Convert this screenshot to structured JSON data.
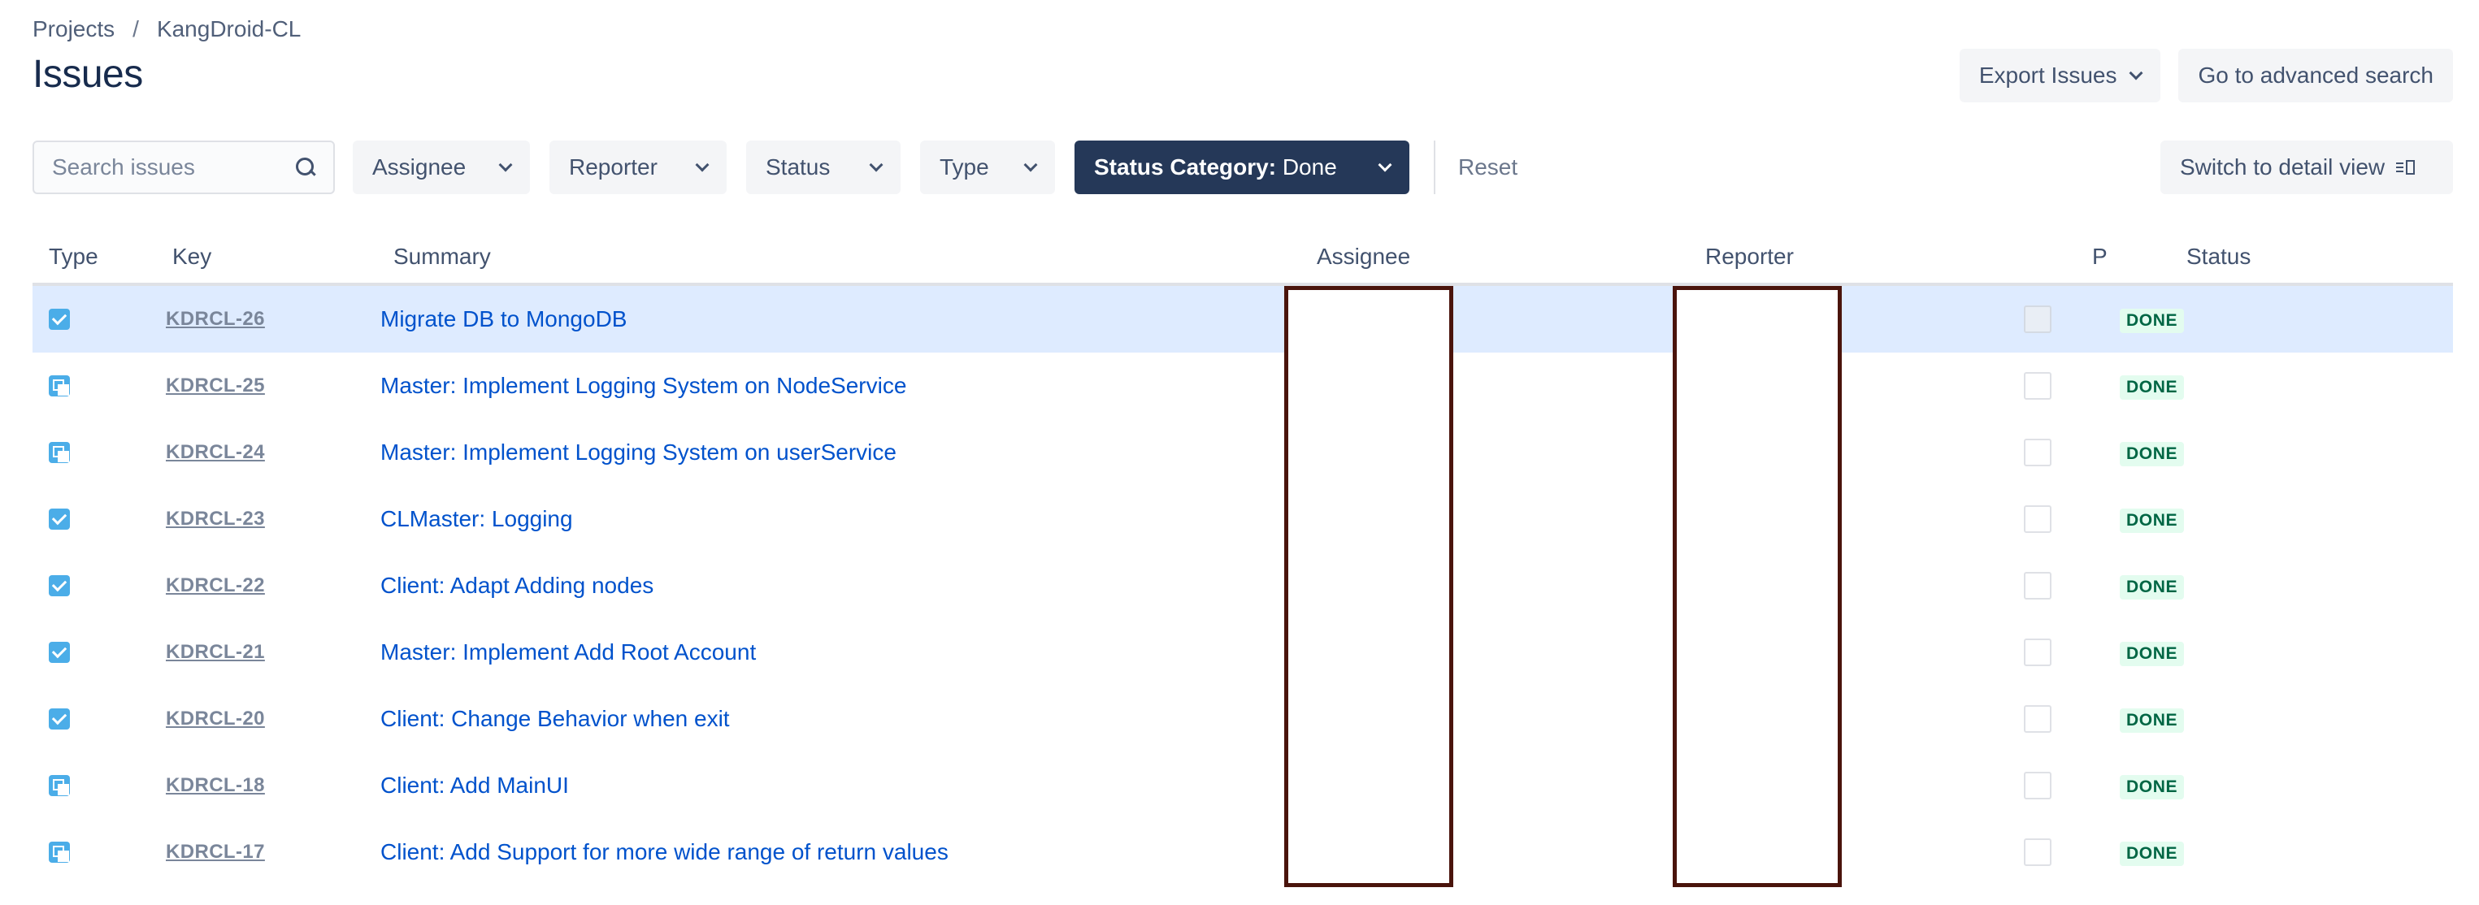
{
  "breadcrumb": {
    "items": [
      "Projects",
      "KangDroid-CL"
    ],
    "separator": "/"
  },
  "page": {
    "title": "Issues"
  },
  "top_actions": {
    "export_label": "Export Issues",
    "advanced_search_label": "Go to advanced search"
  },
  "filters": {
    "search_placeholder": "Search issues",
    "assignee_label": "Assignee",
    "reporter_label": "Reporter",
    "status_label": "Status",
    "type_label": "Type",
    "status_category_key": "Status Category:",
    "status_category_value": "Done",
    "reset_label": "Reset",
    "detail_view_label": "Switch to detail view"
  },
  "table": {
    "headers": {
      "type": "Type",
      "key": "Key",
      "summary": "Summary",
      "assignee": "Assignee",
      "reporter": "Reporter",
      "priority": "P",
      "status": "Status"
    },
    "rows": [
      {
        "type_icon": "task-checkbox-icon",
        "key": "KDRCL-26",
        "summary": "Migrate DB to MongoDB",
        "status": "DONE"
      },
      {
        "type_icon": "subtask-icon",
        "key": "KDRCL-25",
        "summary": "Master: Implement Logging System on NodeService",
        "status": "DONE"
      },
      {
        "type_icon": "subtask-icon",
        "key": "KDRCL-24",
        "summary": "Master: Implement Logging System on userService",
        "status": "DONE"
      },
      {
        "type_icon": "task-checkbox-icon",
        "key": "KDRCL-23",
        "summary": "CLMaster: Logging",
        "status": "DONE"
      },
      {
        "type_icon": "task-checkbox-icon",
        "key": "KDRCL-22",
        "summary": "Client: Adapt Adding nodes",
        "status": "DONE"
      },
      {
        "type_icon": "task-checkbox-icon",
        "key": "KDRCL-21",
        "summary": "Master: Implement Add Root Account",
        "status": "DONE"
      },
      {
        "type_icon": "task-checkbox-icon",
        "key": "KDRCL-20",
        "summary": "Client: Change Behavior when exit",
        "status": "DONE"
      },
      {
        "type_icon": "subtask-icon",
        "key": "KDRCL-18",
        "summary": "Client: Add MainUI",
        "status": "DONE"
      },
      {
        "type_icon": "subtask-icon",
        "key": "KDRCL-17",
        "summary": "Client: Add Support for more wide range of return values",
        "status": "DONE"
      }
    ]
  },
  "colors": {
    "link": "#0052cc",
    "active_filter_bg": "#253858",
    "selected_row": "#deebff",
    "done_lozenge_bg": "#e3fcef",
    "done_lozenge_text": "#006644",
    "type_icon": "#4bade8",
    "redaction_border": "#4a140c"
  }
}
